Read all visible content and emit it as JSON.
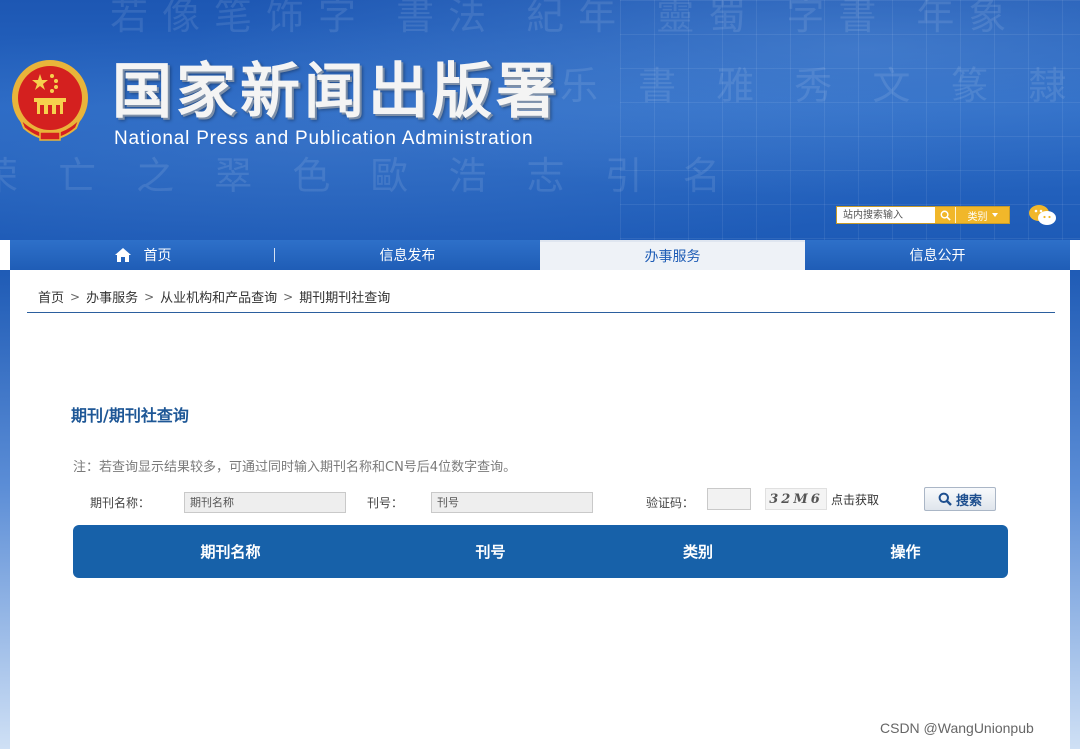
{
  "header": {
    "title": "国家新闻出版署",
    "subtitle": "National  Press and Publication Administration",
    "search_placeholder": "站内搜索输入",
    "category_label": "类别",
    "colors": {
      "primary": "#1f5db6",
      "accent": "#f1b72a",
      "emblem": "#d4201f"
    }
  },
  "nav": {
    "items": [
      {
        "label": "首页",
        "icon": "home-icon"
      },
      {
        "label": "信息发布"
      },
      {
        "label": "办事服务",
        "active": true
      },
      {
        "label": "信息公开"
      }
    ]
  },
  "breadcrumb": [
    "首页",
    "办事服务",
    "从业机构和产品查询",
    "期刊期刊社查询"
  ],
  "breadcrumb_sep": ">",
  "page": {
    "title": "期刊/期刊社查询",
    "note": "注：若查询显示结果较多，可通过同时输入期刊名称和CN号后4位数字查询。"
  },
  "form": {
    "name_label": "期刊名称：",
    "name_placeholder": "期刊名称",
    "issue_label": "刊号：",
    "issue_placeholder": "刊号",
    "captcha_label": "验证码：",
    "captcha_code": "32M6",
    "captcha_refresh": "点击获取",
    "search_label": "搜索"
  },
  "table": {
    "columns": [
      "期刊名称",
      "刊号",
      "类别",
      "操作"
    ]
  },
  "watermark": "CSDN @WangUnionpub"
}
